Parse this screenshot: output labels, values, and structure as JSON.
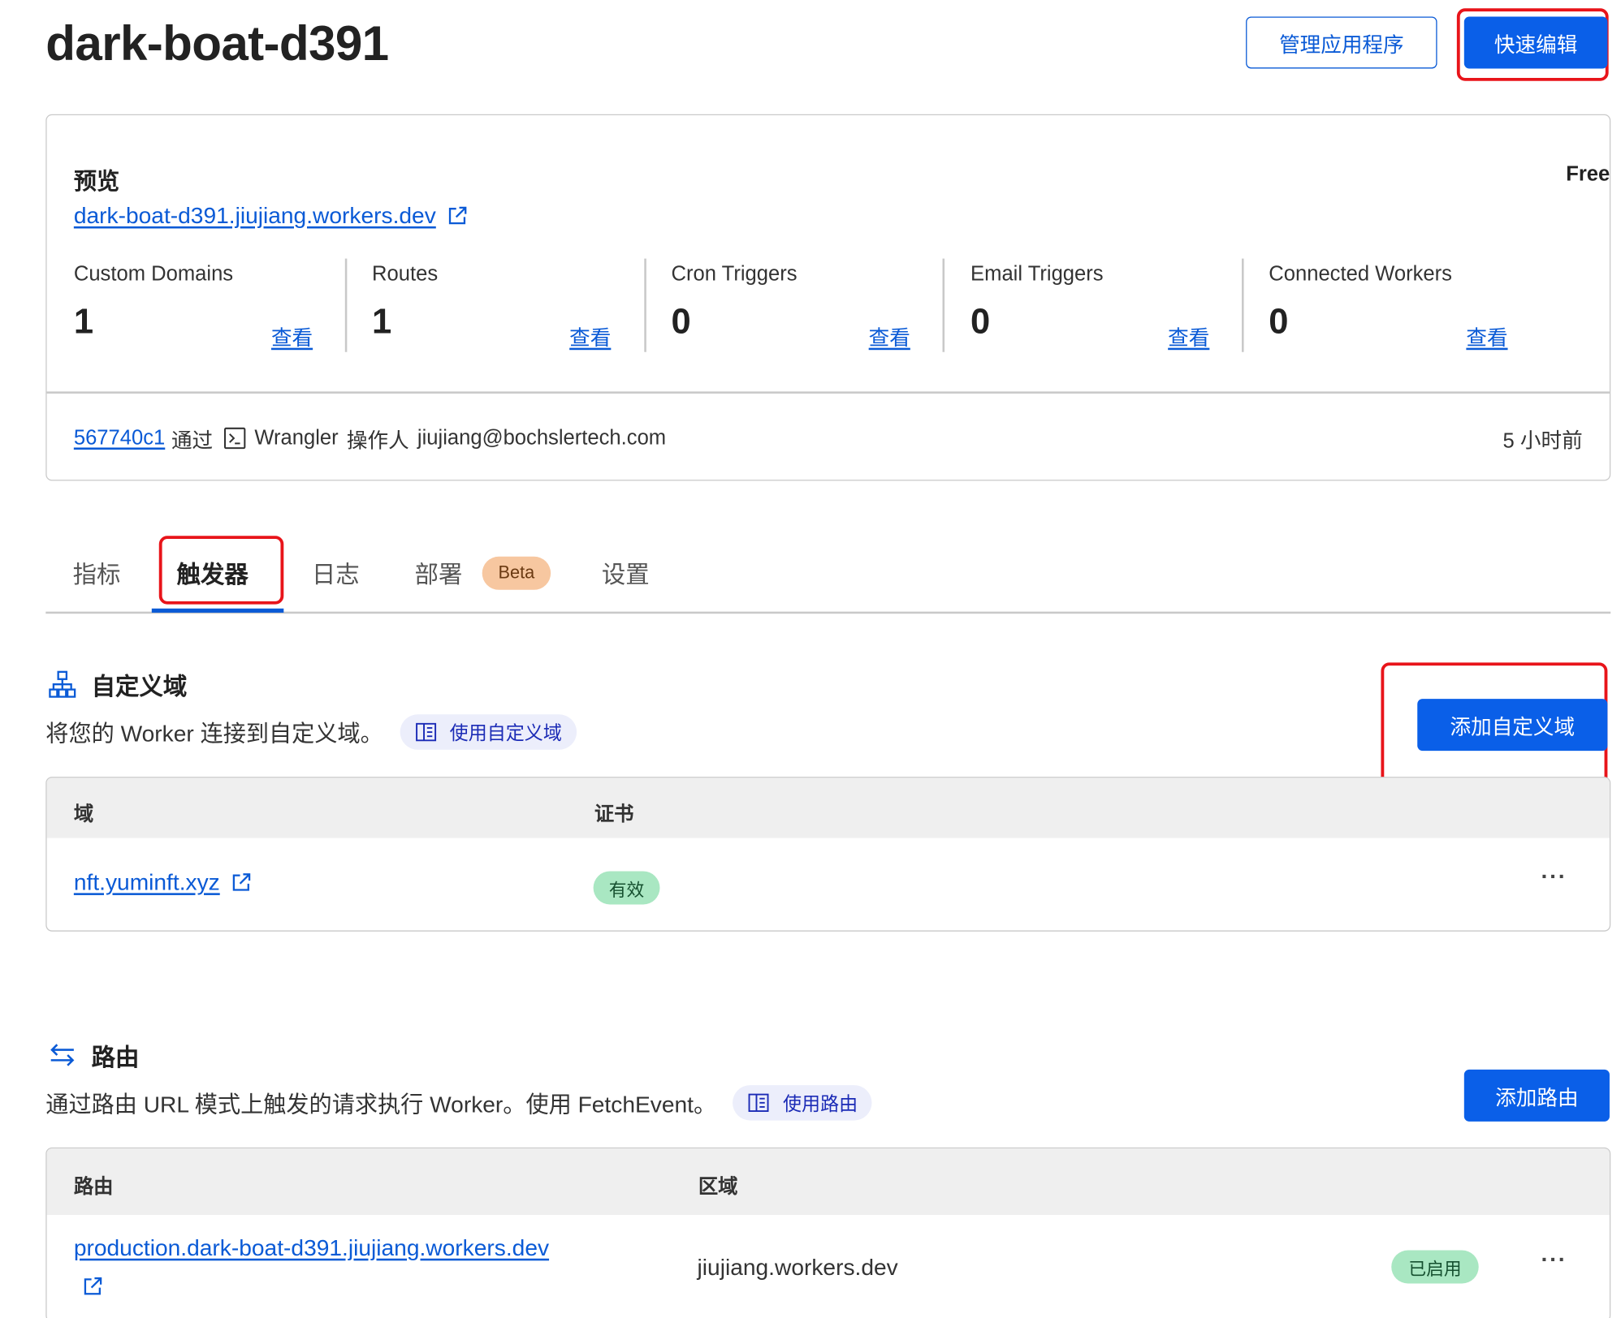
{
  "header": {
    "title": "dark-boat-d391",
    "manage_button": "管理应用程序",
    "quick_edit_button": "快速编辑"
  },
  "overview": {
    "preview_label": "预览",
    "plan_label": "Free",
    "preview_url": "dark-boat-d391.jiujiang.workers.dev",
    "stats": [
      {
        "label": "Custom Domains",
        "value": "1",
        "link": "查看"
      },
      {
        "label": "Routes",
        "value": "1",
        "link": "查看"
      },
      {
        "label": "Cron Triggers",
        "value": "0",
        "link": "查看"
      },
      {
        "label": "Email Triggers",
        "value": "0",
        "link": "查看"
      },
      {
        "label": "Connected Workers",
        "value": "0",
        "link": "查看"
      }
    ],
    "deployment": {
      "commit": "567740c1",
      "via": "通过",
      "source": "Wrangler",
      "operator_label": "操作人",
      "operator": "jiujiang@bochslertech.com",
      "time": "5 小时前"
    }
  },
  "tabs": [
    {
      "label": "指标"
    },
    {
      "label": "触发器"
    },
    {
      "label": "日志"
    },
    {
      "label": "部署"
    },
    {
      "label": "设置"
    }
  ],
  "tabs_badge": "Beta",
  "custom_domains": {
    "title": "自定义域",
    "description": "将您的 Worker 连接到自定义域。",
    "doc_link": "使用自定义域",
    "add_button": "添加自定义域",
    "columns": [
      "域",
      "证书"
    ],
    "rows": [
      {
        "domain": "nft.yuminft.xyz",
        "certificate": "有效"
      }
    ]
  },
  "routes": {
    "title": "路由",
    "description": "通过路由 URL 模式上触发的请求执行 Worker。使用 FetchEvent。",
    "doc_link": "使用路由",
    "add_button": "添加路由",
    "columns": [
      "路由",
      "区域"
    ],
    "rows": [
      {
        "route": "production.dark-boat-d391.jiujiang.workers.dev",
        "zone": "jiujiang.workers.dev",
        "status": "已启用"
      }
    ]
  },
  "colors": {
    "accent": "#0a5fe8",
    "highlight": "#e8141a",
    "valid_badge": "#a9e7c2",
    "beta_badge": "#f7c7a0"
  },
  "icons": [
    "external-link-icon",
    "terminal-icon",
    "sitemap-icon",
    "swap-arrows-icon",
    "book-icon",
    "more-icon"
  ]
}
